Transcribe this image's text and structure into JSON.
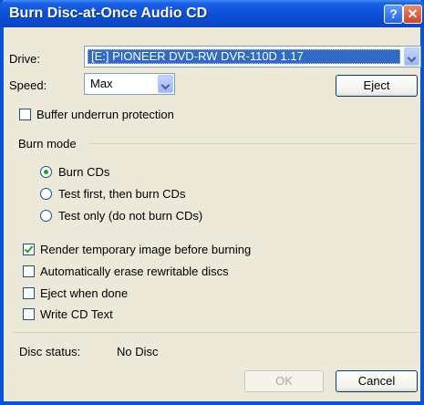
{
  "window": {
    "title": "Burn Disc-at-Once Audio CD",
    "help_icon": "?",
    "close_icon": "✕"
  },
  "drive": {
    "label": "Drive:",
    "value": "[E:] PIONEER DVD-RW  DVR-110D 1.17"
  },
  "speed": {
    "label": "Speed:",
    "value": "Max"
  },
  "eject_button": "Eject",
  "buffer_underrun": {
    "label": "Buffer underrun protection",
    "checked": false
  },
  "burn_mode": {
    "label": "Burn mode",
    "options": [
      {
        "label": "Burn CDs",
        "selected": true
      },
      {
        "label": "Test first, then burn CDs",
        "selected": false
      },
      {
        "label": "Test only (do not burn CDs)",
        "selected": false
      }
    ]
  },
  "options": [
    {
      "label": "Render temporary image before burning",
      "checked": true
    },
    {
      "label": "Automatically erase rewritable discs",
      "checked": false
    },
    {
      "label": "Eject when done",
      "checked": false
    },
    {
      "label": "Write CD Text",
      "checked": false
    }
  ],
  "disc_status": {
    "label": "Disc status:",
    "value": "No Disc"
  },
  "buttons": {
    "ok": "OK",
    "cancel": "Cancel"
  },
  "colors": {
    "title_bar": "#0a4ed6",
    "dialog_bg": "#ece9d8",
    "selection": "#316ac5",
    "check_mark": "#21a121"
  }
}
